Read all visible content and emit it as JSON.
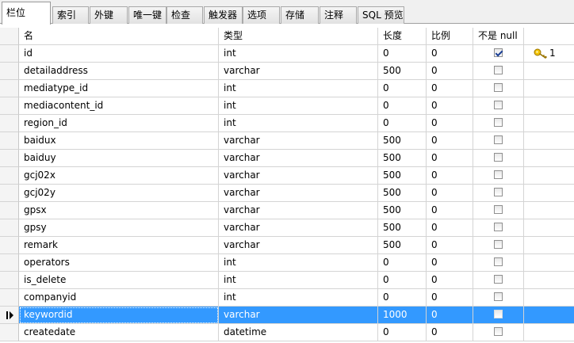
{
  "tabs": [
    {
      "label": "栏位",
      "active": true
    },
    {
      "label": "索引"
    },
    {
      "label": "外键"
    },
    {
      "label": "唯一键"
    },
    {
      "label": "检查"
    },
    {
      "label": "触发器"
    },
    {
      "label": "选项"
    },
    {
      "label": "存储"
    },
    {
      "label": "注释"
    },
    {
      "label": "SQL 预览"
    }
  ],
  "columns": [
    "名",
    "类型",
    "长度",
    "比例",
    "不是 null",
    ""
  ],
  "rows": [
    {
      "name": "id",
      "type": "int",
      "length": "0",
      "scale": "0",
      "not_null": true,
      "key": "1"
    },
    {
      "name": "detailaddress",
      "type": "varchar",
      "length": "500",
      "scale": "0",
      "not_null": false
    },
    {
      "name": "mediatype_id",
      "type": "int",
      "length": "0",
      "scale": "0",
      "not_null": false
    },
    {
      "name": "mediacontent_id",
      "type": "int",
      "length": "0",
      "scale": "0",
      "not_null": false
    },
    {
      "name": "region_id",
      "type": "int",
      "length": "0",
      "scale": "0",
      "not_null": false
    },
    {
      "name": "baidux",
      "type": "varchar",
      "length": "500",
      "scale": "0",
      "not_null": false
    },
    {
      "name": "baiduy",
      "type": "varchar",
      "length": "500",
      "scale": "0",
      "not_null": false
    },
    {
      "name": "gcj02x",
      "type": "varchar",
      "length": "500",
      "scale": "0",
      "not_null": false
    },
    {
      "name": "gcj02y",
      "type": "varchar",
      "length": "500",
      "scale": "0",
      "not_null": false
    },
    {
      "name": "gpsx",
      "type": "varchar",
      "length": "500",
      "scale": "0",
      "not_null": false
    },
    {
      "name": "gpsy",
      "type": "varchar",
      "length": "500",
      "scale": "0",
      "not_null": false
    },
    {
      "name": "remark",
      "type": "varchar",
      "length": "500",
      "scale": "0",
      "not_null": false
    },
    {
      "name": "operators",
      "type": "int",
      "length": "0",
      "scale": "0",
      "not_null": false
    },
    {
      "name": "is_delete",
      "type": "int",
      "length": "0",
      "scale": "0",
      "not_null": false
    },
    {
      "name": "companyid",
      "type": "int",
      "length": "0",
      "scale": "0",
      "not_null": false
    },
    {
      "name": "keywordid",
      "type": "varchar",
      "length": "1000",
      "scale": "0",
      "not_null": false,
      "selected": true
    },
    {
      "name": "createdate",
      "type": "datetime",
      "length": "0",
      "scale": "0",
      "not_null": false
    }
  ],
  "colors": {
    "selection": "#3399ff",
    "key_icon": "#e8b400"
  },
  "icons": {
    "primary_key": "key-icon",
    "current_row": "row-pointer-icon"
  }
}
